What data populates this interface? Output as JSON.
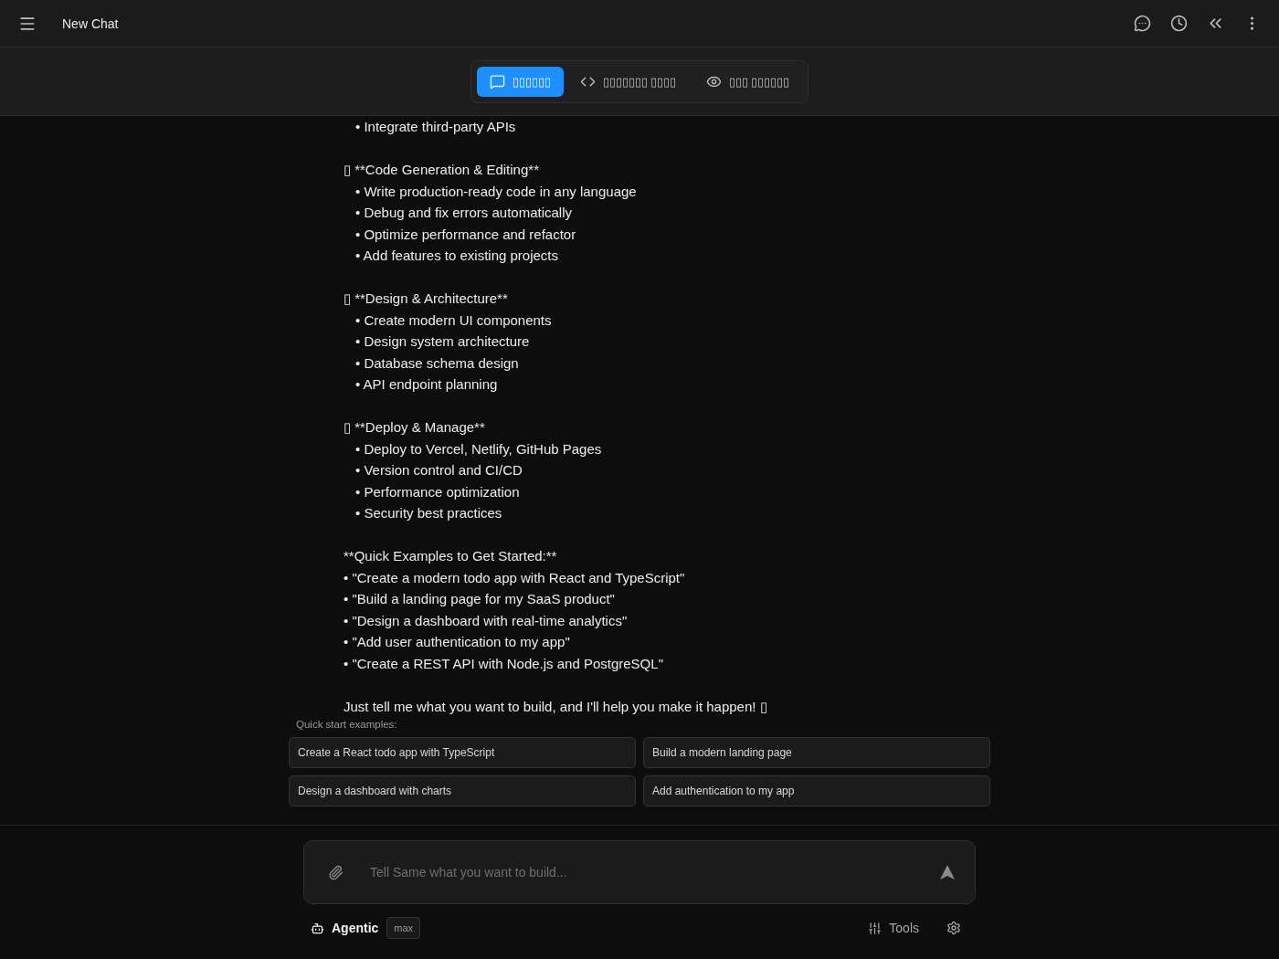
{
  "header": {
    "title": "New Chat"
  },
  "tabs": [
    {
      "kind": "chat",
      "label": "▯▯▯▯▯▯",
      "selected": true
    },
    {
      "kind": "code",
      "label": "▯▯▯▯▯▯▯ ▯▯▯▯",
      "selected": false
    },
    {
      "kind": "preview",
      "label": "▯▯▯ ▯▯▯▯▯▯",
      "selected": false
    }
  ],
  "message": {
    "blocks": [
      {
        "lines": [
          "• Integrate third-party APIs"
        ]
      },
      {
        "lines": [
          "▯ **Code Generation & Editing**",
          "• Write production-ready code in any language",
          "• Debug and fix errors automatically",
          "• Optimize performance and refactor",
          "• Add features to existing projects"
        ]
      },
      {
        "lines": [
          "▯ **Design & Architecture**",
          "• Create modern UI components",
          "• Design system architecture",
          "• Database schema design",
          "• API endpoint planning"
        ]
      },
      {
        "lines": [
          "▯ **Deploy & Manage**",
          "• Deploy to Vercel, Netlify, GitHub Pages",
          "• Version control and CI/CD",
          "• Performance optimization",
          "• Security best practices"
        ]
      },
      {
        "lines": [
          "**Quick Examples to Get Started:**",
          "• \"Create a modern todo app with React and TypeScript\"",
          "• \"Build a landing page for my SaaS product\"",
          "• \"Design a dashboard with real-time analytics\"",
          "• \"Add user authentication to my app\"",
          "• \"Create a REST API with Node.js and PostgreSQL\""
        ]
      },
      {
        "lines": [
          "Just tell me what you want to build, and I'll help you make it happen! ▯"
        ]
      }
    ]
  },
  "quick_start": {
    "label": "Quick start examples:",
    "examples": [
      "Create a React todo app with TypeScript",
      "Build a modern landing page",
      "Design a dashboard with charts",
      "Add authentication to my app"
    ]
  },
  "composer": {
    "placeholder": "Tell Same what you want to build..."
  },
  "footer": {
    "mode": "Agentic",
    "badge": "max",
    "tools": "Tools"
  }
}
